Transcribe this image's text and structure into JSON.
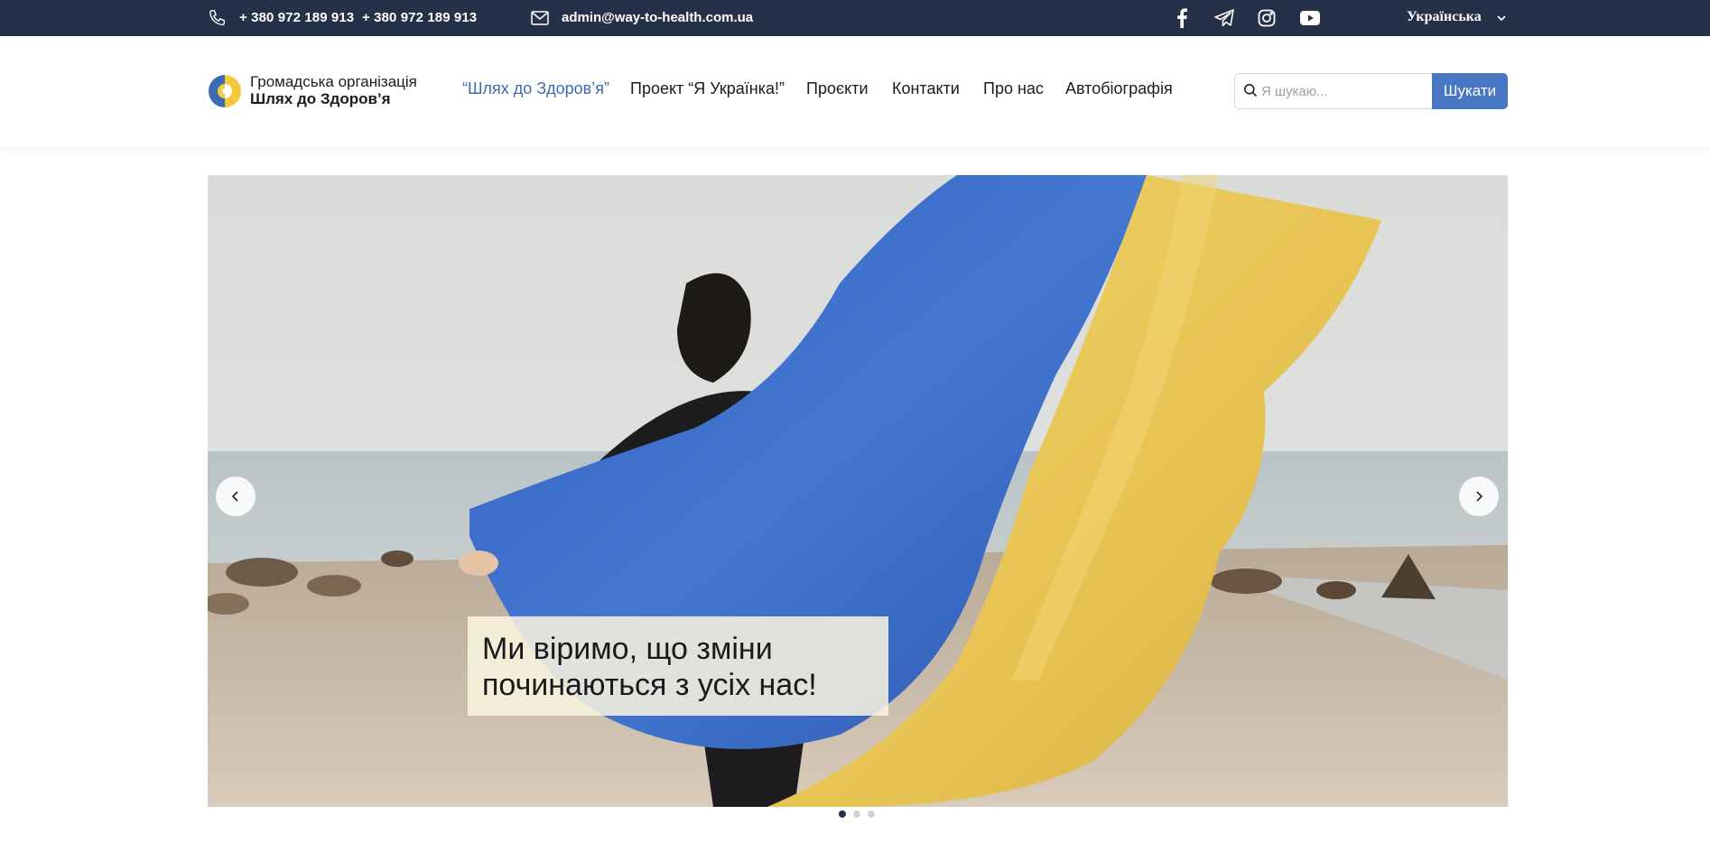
{
  "topbar": {
    "phone1": "+ 380 972 189 913",
    "phone2": "+ 380 972 189 913",
    "email": "admin@way-to-health.com.ua",
    "social_icons": [
      "facebook-icon",
      "telegram-icon",
      "instagram-icon",
      "youtube-icon"
    ],
    "language": "Українська"
  },
  "header": {
    "logo_line1": "Громадська організація",
    "logo_line2": "Шлях до Здоров’я",
    "nav": [
      {
        "label": "“Шлях до Здоров’я”",
        "active": true
      },
      {
        "label": "Проект “Я Українка!”",
        "active": false
      },
      {
        "label": "Проєкти",
        "active": false
      },
      {
        "label": "Контакти",
        "active": false
      },
      {
        "label": "Про нас",
        "active": false
      },
      {
        "label": "Автобіографія",
        "active": false
      }
    ],
    "search": {
      "placeholder": "Я шукаю...",
      "button_label": "Шукати"
    }
  },
  "hero": {
    "caption": "Ми віримо, що зміни починаються з усіх нас!",
    "slides_count": 3,
    "active_slide": 1
  },
  "colors": {
    "topbar_bg": "#253148",
    "accent_blue": "#4a77c3",
    "nav_active": "#3d6bb3",
    "flag_blue": "#3566c4",
    "flag_yellow": "#e8c552"
  }
}
